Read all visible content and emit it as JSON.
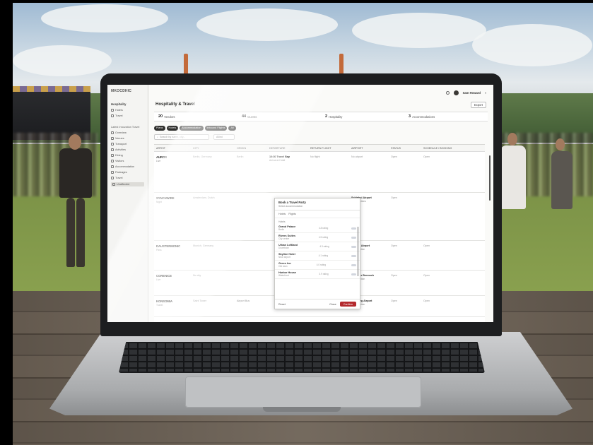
{
  "app": {
    "brand": "MKOCDHIC",
    "page_title": "Hospitality & Travel",
    "export_label": "Export",
    "user": {
      "name": "Sam Howard"
    }
  },
  "sidebar": {
    "section_main": "Hospitality",
    "items_main": [
      {
        "label": "Hotels",
        "icon": "grid-icon"
      },
      {
        "label": "Travel",
        "icon": "plane-icon"
      }
    ],
    "section_secondary": "Latest Innovation Travel",
    "items_secondary": [
      {
        "label": "Overview",
        "icon": "eye-icon"
      },
      {
        "label": "Venues",
        "icon": "pin-icon"
      },
      {
        "label": "Transport",
        "icon": "car-icon"
      },
      {
        "label": "Activities",
        "icon": "star-icon"
      },
      {
        "label": "Dining",
        "icon": "fork-icon"
      },
      {
        "label": "Visitors",
        "icon": "users-icon"
      },
      {
        "label": "Accommodation",
        "icon": "bed-icon"
      },
      {
        "label": "Packages",
        "icon": "box-icon"
      },
      {
        "label": "Travel",
        "icon": "plane-icon"
      },
      {
        "label": "Unaffected",
        "icon": "list-icon"
      }
    ]
  },
  "stats": [
    {
      "value": "20",
      "label": "Vendors"
    },
    {
      "value": "44",
      "label": "Guests"
    },
    {
      "value": "2",
      "label": "Hospitality"
    },
    {
      "value": "3",
      "label": "Accommodations"
    }
  ],
  "chips": [
    "Plans",
    "Hotels",
    "Accommodation",
    "Inbound Flights",
    "All"
  ],
  "filters": {
    "search_placeholder": "Search by name, city...",
    "select_value": "Allied"
  },
  "table": {
    "columns": [
      "ARTIST",
      "CITY",
      "ORIGIN",
      "DEPARTURE",
      "RETURN FLIGHT",
      "AIRPORT",
      "STATUS",
      "SCHEDULE / BOOKING"
    ],
    "rows": [
      {
        "artist": "AUROS",
        "artist_sub": "Live",
        "city": "Berlin, Germany",
        "origin": "Berlin",
        "departure": "10:30 Travel Bay",
        "departure_sub": "Arrival at Hotel",
        "return": "No flight",
        "airport": "No airport",
        "status": "Open",
        "schedule": "Open"
      },
      {
        "artist": "SYNCHWIRE",
        "artist_sub": "Night",
        "city": "Amsterdam, Dutch",
        "origin": "",
        "departure": "",
        "departure_sub": "",
        "return": "",
        "airport": "Schiphol Airport",
        "airport_sub": "2 connections",
        "status": "Open",
        "schedule": ""
      },
      {
        "artist": "DAUSTERMONIC",
        "artist_sub": "Pass",
        "city": "Munich, Germany",
        "origin": "",
        "departure": "",
        "departure_sub": "",
        "return": "",
        "airport": "Munich Airport",
        "airport_sub": "1 connection",
        "status": "Open",
        "schedule": "Open"
      },
      {
        "artist": "CORENICE",
        "artist_sub": "Live",
        "city": "No city",
        "origin": "",
        "departure": "",
        "departure_sub": "",
        "return": "",
        "airport": "Dr. Peter Bremsch",
        "airport_sub": "1 connection",
        "status": "Open",
        "schedule": "Open"
      },
      {
        "artist": "KONSOMIA",
        "artist_sub": "Travel",
        "city": "Saint Tower",
        "origin": "Airport Bus",
        "departure": "",
        "departure_sub": "",
        "return": "",
        "airport": "Hamburg Airport",
        "airport_sub": "1 connection",
        "status": "Open",
        "schedule": "Open"
      }
    ]
  },
  "popup": {
    "title": "Book a Travel Party",
    "subtitle": "Select accommodation",
    "tabs": [
      "Hotels",
      "Flights"
    ],
    "list_label": "Hotels",
    "options": [
      {
        "name": "Grand Palace",
        "sub": "Berlin",
        "meta": "4.8 rating"
      },
      {
        "name": "Rivers Suites",
        "sub": "City centre",
        "meta": "4.5 rating"
      },
      {
        "name": "Urban Loftland",
        "sub": "Downtown",
        "meta": "4.3 rating"
      },
      {
        "name": "Skyline Hotel",
        "sub": "Near airport",
        "meta": "4.1 rating"
      },
      {
        "name": "Green Inn",
        "sub": "Old town",
        "meta": "4.0 rating"
      },
      {
        "name": "Harbor House",
        "sub": "Waterfront",
        "meta": "3.9 rating"
      },
      {
        "name": "Alpine Lodge",
        "sub": "Hillside",
        "meta": "3.8 rating"
      }
    ],
    "reset_label": "Reset",
    "cancel_label": "Close",
    "apply_label": "Confirm"
  },
  "colors": {
    "accent": "#b42a2e",
    "chip_bg": "#2f2f2d",
    "screen_bg": "#ececea"
  }
}
